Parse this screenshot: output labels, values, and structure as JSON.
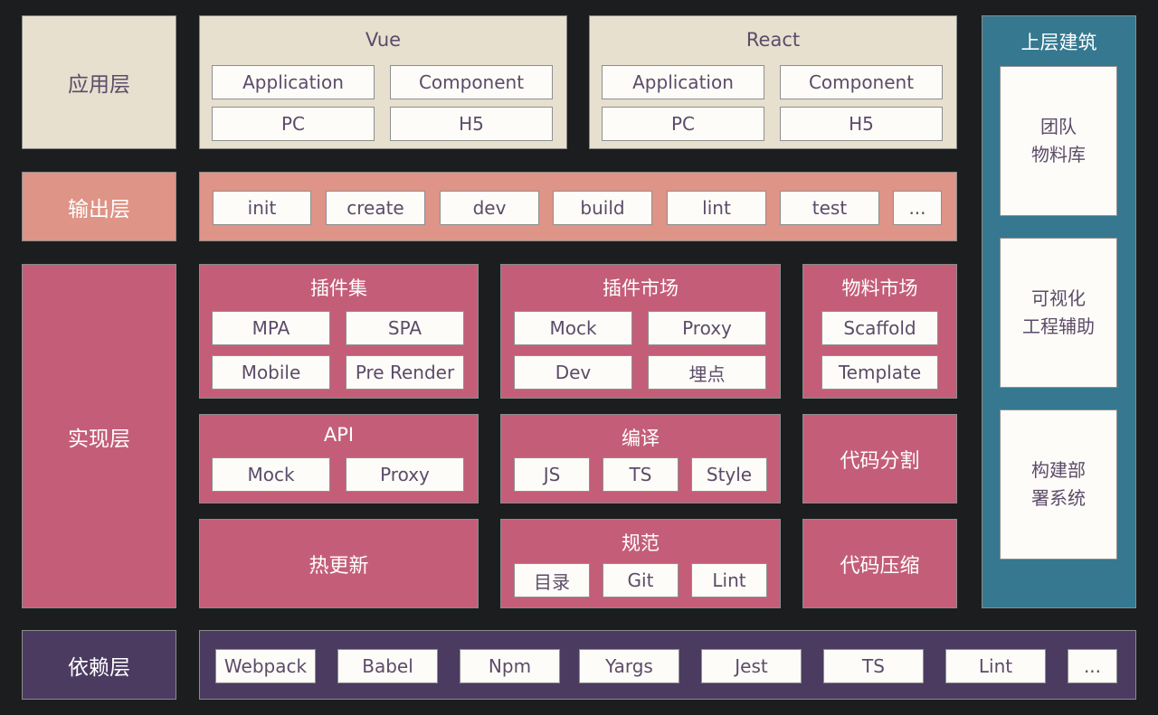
{
  "colors": {
    "background": "#1c1d1f",
    "application_layer": "#e7e0cf",
    "output_layer": "#de9486",
    "implementation_layer": "#c45e78",
    "superstructure": "#35788f",
    "dependency_layer": "#4b3b60",
    "cell": "#fdfcf8",
    "cell_text": "#5c4b69"
  },
  "layers": {
    "application": "应用层",
    "output": "输出层",
    "implementation": "实现层",
    "dependency": "依赖层"
  },
  "application": {
    "vue": {
      "title": "Vue",
      "items": [
        "Application",
        "Component",
        "PC",
        "H5"
      ]
    },
    "react": {
      "title": "React",
      "items": [
        "Application",
        "Component",
        "PC",
        "H5"
      ]
    }
  },
  "output": {
    "commands": [
      "init",
      "create",
      "dev",
      "build",
      "lint",
      "test",
      "..."
    ]
  },
  "implementation": {
    "plugin_set": {
      "title": "插件集",
      "items": [
        "MPA",
        "SPA",
        "Mobile",
        "Pre Render"
      ]
    },
    "plugin_market": {
      "title": "插件市场",
      "items": [
        "Mock",
        "Proxy",
        "Dev",
        "埋点"
      ]
    },
    "material_market": {
      "title": "物料市场",
      "items": [
        "Scaffold",
        "Template"
      ]
    },
    "api": {
      "title": "API",
      "items": [
        "Mock",
        "Proxy"
      ]
    },
    "compile": {
      "title": "编译",
      "items": [
        "JS",
        "TS",
        "Style"
      ]
    },
    "code_split": {
      "title": "代码分割"
    },
    "hot_reload": {
      "title": "热更新"
    },
    "standards": {
      "title": "规范",
      "items": [
        "目录",
        "Git",
        "Lint"
      ]
    },
    "code_compress": {
      "title": "代码压缩"
    }
  },
  "superstructure": {
    "title": "上层建筑",
    "items": [
      {
        "line1": "团队",
        "line2": "物料库"
      },
      {
        "line1": "可视化",
        "line2": "工程辅助"
      },
      {
        "line1": "构建部",
        "line2": "署系统"
      }
    ]
  },
  "dependency": {
    "items": [
      "Webpack",
      "Babel",
      "Npm",
      "Yargs",
      "Jest",
      "TS",
      "Lint",
      "..."
    ]
  }
}
